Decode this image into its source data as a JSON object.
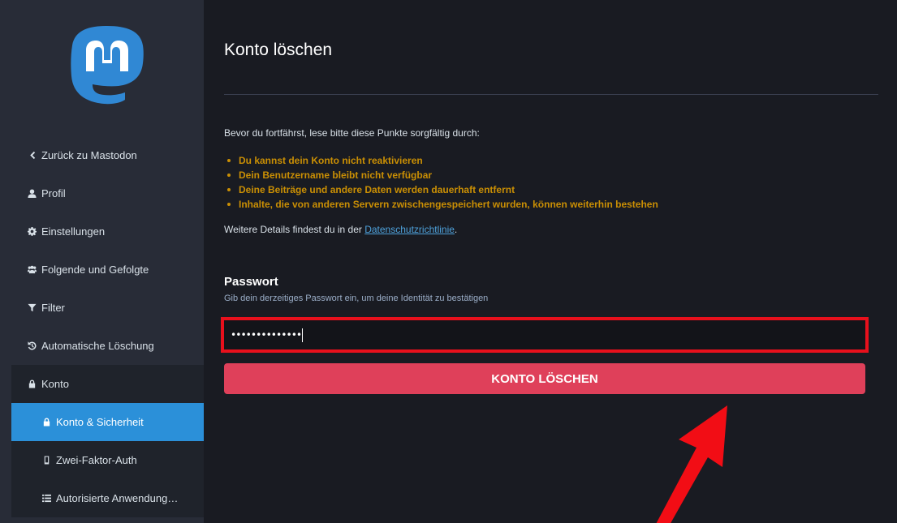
{
  "colors": {
    "accent": "#2b90d9",
    "danger": "#df405a",
    "warning": "#ca8f04",
    "highlight": "#e8101c"
  },
  "sidebar": {
    "logo_icon": "mastodon-logo-icon",
    "items": [
      {
        "label": "Zurück zu Mastodon",
        "icon": "chevron-left-icon"
      },
      {
        "label": "Profil",
        "icon": "user-icon"
      },
      {
        "label": "Einstellungen",
        "icon": "gear-icon"
      },
      {
        "label": "Folgende und Gefolgte",
        "icon": "users-icon"
      },
      {
        "label": "Filter",
        "icon": "filter-icon"
      },
      {
        "label": "Automatische Löschung",
        "icon": "history-icon"
      },
      {
        "label": "Konto",
        "icon": "lock-icon"
      }
    ],
    "subitems": [
      {
        "label": "Konto & Sicherheit",
        "icon": "lock-icon",
        "active": true
      },
      {
        "label": "Zwei-Faktor-Auth",
        "icon": "mobile-icon"
      },
      {
        "label": "Autorisierte Anwendung…",
        "icon": "list-icon"
      }
    ]
  },
  "main": {
    "title": "Konto löschen",
    "intro": "Bevor du fortfährst, lese bitte diese Punkte sorgfältig durch:",
    "warnings": [
      "Du kannst dein Konto nicht reaktivieren",
      "Dein Benutzername bleibt nicht verfügbar",
      "Deine Beiträge und andere Daten werden dauerhaft entfernt",
      "Inhalte, die von anderen Servern zwischengespeichert wurden, können weiterhin bestehen"
    ],
    "details_prefix": "Weitere Details findest du in der ",
    "details_link": "Datenschutzrichtlinie",
    "details_suffix": ".",
    "password_label": "Passwort",
    "password_hint": "Gib dein derzeitiges Passwort ein, um deine Identität zu bestätigen",
    "password_value": "••••••••••••••",
    "delete_button": "KONTO LÖSCHEN"
  }
}
